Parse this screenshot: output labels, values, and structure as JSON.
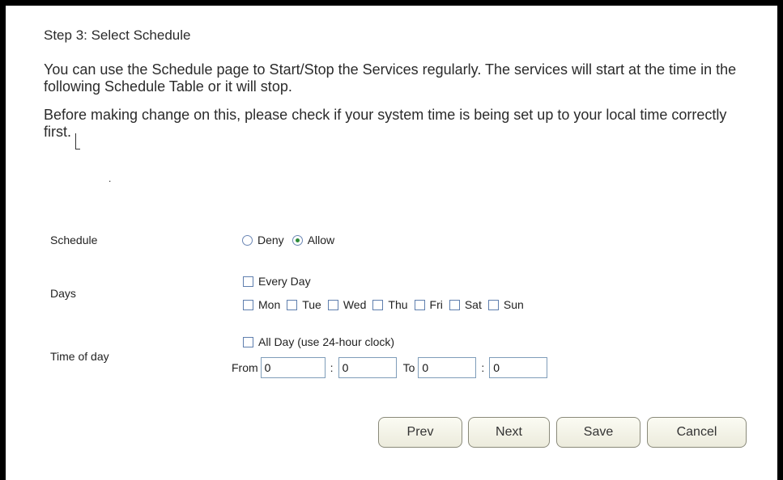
{
  "step_title": "Step 3: Select Schedule",
  "intro": "You can use the Schedule page to Start/Stop the Services regularly. The services will start at the time in the following Schedule Table or it will stop.",
  "note": "Before making change on this, please check if your system time is being set up to your local time correctly first.",
  "stray_dot": ".",
  "form": {
    "schedule_label": "Schedule",
    "schedule_options": [
      {
        "label": "Deny",
        "selected": false
      },
      {
        "label": "Allow",
        "selected": true
      }
    ],
    "days_label": "Days",
    "every_day_label": "Every Day",
    "day_options": [
      "Mon",
      "Tue",
      "Wed",
      "Thu",
      "Fri",
      "Sat",
      "Sun"
    ],
    "time_label": "Time of day",
    "all_day_label": "All Day (use 24-hour clock)",
    "from_label": "From",
    "to_label": "To",
    "time_separator": ":",
    "from_hour": "0",
    "from_minute": "0",
    "to_hour": "0",
    "to_minute": "0"
  },
  "buttons": {
    "prev": "Prev",
    "next": "Next",
    "save": "Save",
    "cancel": "Cancel"
  },
  "colors": {
    "radio_selected": "#2e8b3a",
    "control_border": "#5f7fae",
    "frame": "#000000"
  }
}
